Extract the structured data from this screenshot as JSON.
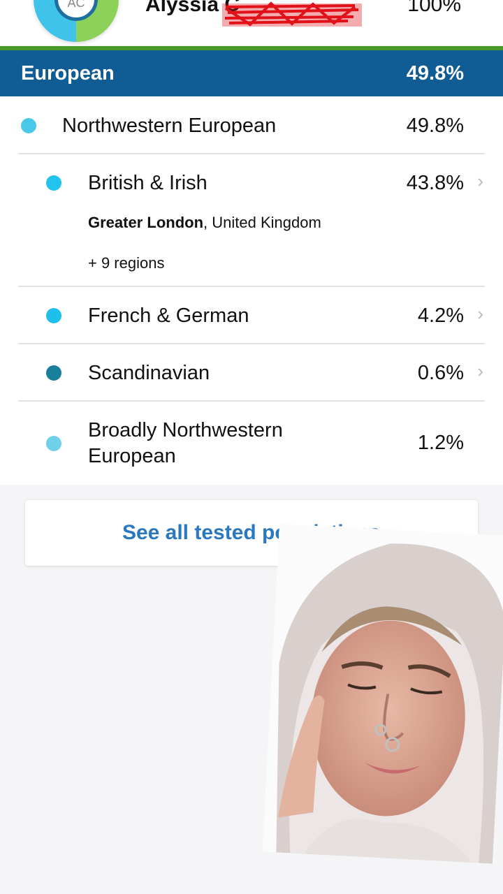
{
  "header": {
    "avatar_initials": "AC",
    "user_name": "Alyssia C",
    "user_percent": "100%"
  },
  "section": {
    "label": "European",
    "percent": "49.8%"
  },
  "rows": [
    {
      "name": "Northwestern European",
      "percent": "49.8%",
      "color": "#4ac8e8"
    },
    {
      "name": "British & Irish",
      "percent": "43.8%",
      "color": "#22c4ef",
      "location_bold": "Greater London",
      "location_rest": ", United Kingdom",
      "more_regions": "+ 9 regions"
    },
    {
      "name": "French & German",
      "percent": "4.2%",
      "color": "#1fbfeb"
    },
    {
      "name": "Scandinavian",
      "percent": "0.6%",
      "color": "#1a7f9c"
    },
    {
      "name_line1": "Broadly Northwestern",
      "name_line2": "European",
      "percent": "1.2%",
      "color": "#6fd0ea"
    }
  ],
  "chevron": "›",
  "see_all_label": "See all tested populations"
}
